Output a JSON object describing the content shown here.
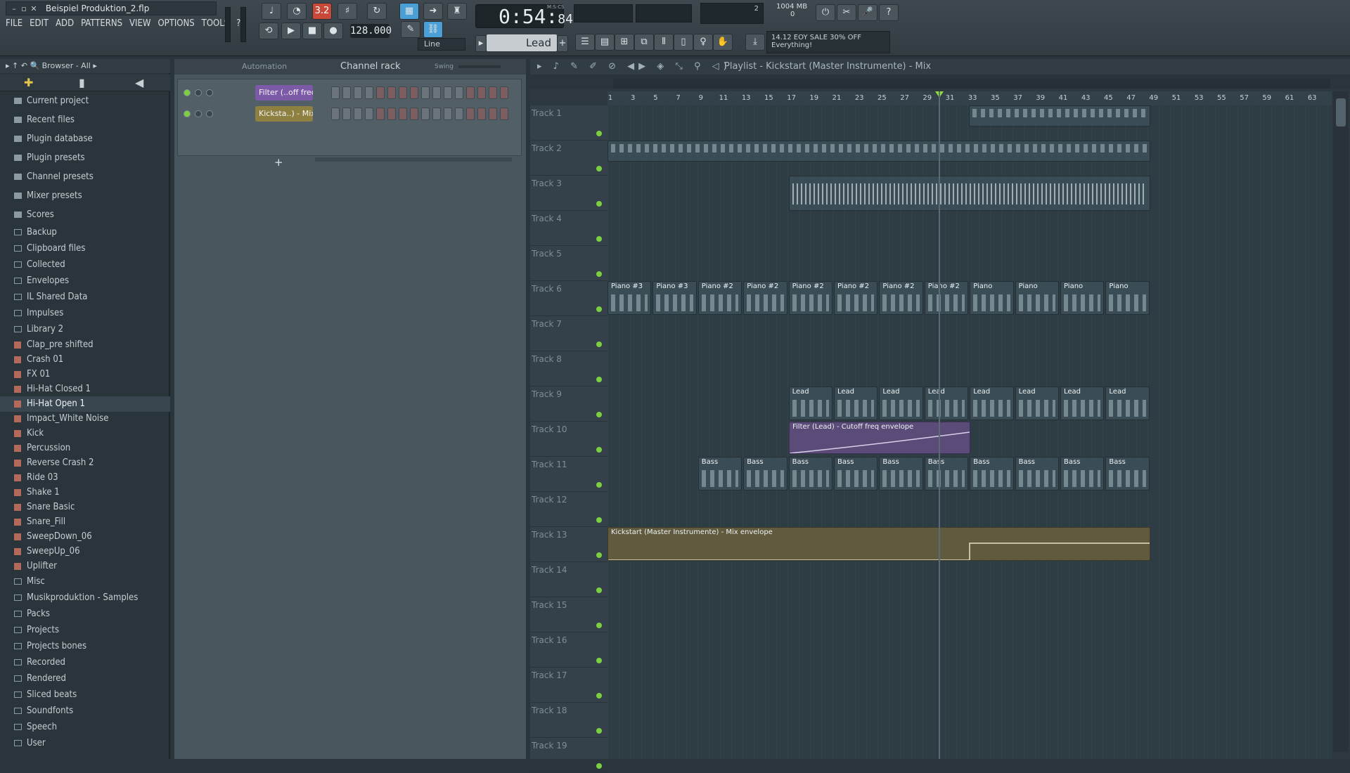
{
  "window": {
    "title": "Beispiel Produktion_2.flp"
  },
  "menu": [
    "FILE",
    "EDIT",
    "ADD",
    "PATTERNS",
    "VIEW",
    "OPTIONS",
    "TOOLS",
    "?"
  ],
  "transport": {
    "song_position": "0:54",
    "song_position_ticks": "84",
    "position_label": "M:S:CS",
    "tempo": "128.000",
    "pattern": "Lead",
    "snap": "Line",
    "counter_top": "2",
    "mem": "1004 MB",
    "counter_bottom": "0"
  },
  "hint": {
    "line1": "14.12  EOY SALE 30% OFF",
    "line2": "Everything!"
  },
  "browser": {
    "title": "Browser - All",
    "items": [
      {
        "label": "Current project",
        "type": "top"
      },
      {
        "label": "Recent files",
        "type": "top"
      },
      {
        "label": "Plugin database",
        "type": "top"
      },
      {
        "label": "Plugin presets",
        "type": "top"
      },
      {
        "label": "Channel presets",
        "type": "top"
      },
      {
        "label": "Mixer presets",
        "type": "top"
      },
      {
        "label": "Scores",
        "type": "top"
      },
      {
        "label": "Backup",
        "type": "folder"
      },
      {
        "label": "Clipboard files",
        "type": "folder"
      },
      {
        "label": "Collected",
        "type": "folder"
      },
      {
        "label": "Envelopes",
        "type": "folder"
      },
      {
        "label": "IL Shared Data",
        "type": "folder"
      },
      {
        "label": "Impulses",
        "type": "folder"
      },
      {
        "label": "Library 2",
        "type": "folder"
      },
      {
        "label": "Clap_pre shifted",
        "type": "file"
      },
      {
        "label": "Crash 01",
        "type": "file"
      },
      {
        "label": "FX 01",
        "type": "file"
      },
      {
        "label": "Hi-Hat Closed 1",
        "type": "file"
      },
      {
        "label": "Hi-Hat Open 1",
        "type": "file"
      },
      {
        "label": "Impact_White Noise",
        "type": "file"
      },
      {
        "label": "Kick",
        "type": "file"
      },
      {
        "label": "Percussion",
        "type": "file"
      },
      {
        "label": "Reverse Crash 2",
        "type": "file"
      },
      {
        "label": "Ride 03",
        "type": "file"
      },
      {
        "label": "Shake 1",
        "type": "file"
      },
      {
        "label": "Snare Basic",
        "type": "file"
      },
      {
        "label": "Snare_Fill",
        "type": "file"
      },
      {
        "label": "SweepDown_06",
        "type": "file"
      },
      {
        "label": "SweepUp_06",
        "type": "file"
      },
      {
        "label": "Uplifter",
        "type": "file"
      },
      {
        "label": "Misc",
        "type": "folder"
      },
      {
        "label": "Musikproduktion - Samples",
        "type": "folder"
      },
      {
        "label": "Packs",
        "type": "folder"
      },
      {
        "label": "Projects",
        "type": "folder"
      },
      {
        "label": "Projects bones",
        "type": "folder"
      },
      {
        "label": "Recorded",
        "type": "folder"
      },
      {
        "label": "Rendered",
        "type": "folder"
      },
      {
        "label": "Sliced beats",
        "type": "folder"
      },
      {
        "label": "Soundfonts",
        "type": "folder"
      },
      {
        "label": "Speech",
        "type": "folder"
      },
      {
        "label": "User",
        "type": "folder"
      }
    ]
  },
  "channel_rack": {
    "title": "Channel rack",
    "filter": "Automation",
    "swing_label": "Swing",
    "channels": [
      {
        "name": "Filter (..off freq",
        "color": "#7d5aa8"
      },
      {
        "name": "Kicksta..) - Mix",
        "color": "#8d8040"
      }
    ]
  },
  "playlist": {
    "title": "Playlist - Kickstart (Master Instrumente) - Mix",
    "ruler": [
      "1",
      "3",
      "5",
      "7",
      "9",
      "11",
      "13",
      "15",
      "17",
      "19",
      "21",
      "23",
      "25",
      "27",
      "29",
      "31",
      "33",
      "35",
      "37",
      "39",
      "41",
      "43",
      "45",
      "47",
      "49",
      "51",
      "53",
      "55",
      "57",
      "59",
      "61",
      "63"
    ],
    "tracks": [
      "Track 1",
      "Track 2",
      "Track 3",
      "Track 4",
      "Track 5",
      "Track 6",
      "Track 7",
      "Track 8",
      "Track 9",
      "Track 10",
      "Track 11",
      "Track 12",
      "Track 13",
      "Track 14",
      "Track 15",
      "Track 16",
      "Track 17",
      "Track 18",
      "Track 19"
    ],
    "clips": [
      {
        "track": 6,
        "label": "Piano #3",
        "bar": 1
      },
      {
        "track": 6,
        "label": "Piano #3",
        "bar": 5
      },
      {
        "track": 6,
        "label": "Piano #2",
        "bar": 9
      },
      {
        "track": 6,
        "label": "Piano #2",
        "bar": 13
      },
      {
        "track": 6,
        "label": "Piano #2",
        "bar": 17
      },
      {
        "track": 6,
        "label": "Piano #2",
        "bar": 21
      },
      {
        "track": 6,
        "label": "Piano #2",
        "bar": 25
      },
      {
        "track": 6,
        "label": "Piano #2",
        "bar": 29
      },
      {
        "track": 6,
        "label": "Piano",
        "bar": 33
      },
      {
        "track": 6,
        "label": "Piano",
        "bar": 37
      },
      {
        "track": 6,
        "label": "Piano",
        "bar": 41
      },
      {
        "track": 6,
        "label": "Piano",
        "bar": 45
      },
      {
        "track": 9,
        "label": "Lead",
        "bar": 17
      },
      {
        "track": 9,
        "label": "Lead",
        "bar": 21
      },
      {
        "track": 9,
        "label": "Lead",
        "bar": 25
      },
      {
        "track": 9,
        "label": "Lead",
        "bar": 29
      },
      {
        "track": 9,
        "label": "Lead",
        "bar": 33
      },
      {
        "track": 9,
        "label": "Lead",
        "bar": 37
      },
      {
        "track": 9,
        "label": "Lead",
        "bar": 41
      },
      {
        "track": 9,
        "label": "Lead",
        "bar": 45
      },
      {
        "track": 11,
        "label": "Bass",
        "bar": 9
      },
      {
        "track": 11,
        "label": "Bass",
        "bar": 13
      },
      {
        "track": 11,
        "label": "Bass",
        "bar": 17
      },
      {
        "track": 11,
        "label": "Bass",
        "bar": 21
      },
      {
        "track": 11,
        "label": "Bass",
        "bar": 25
      },
      {
        "track": 11,
        "label": "Bass",
        "bar": 29
      },
      {
        "track": 11,
        "label": "Bass",
        "bar": 33
      },
      {
        "track": 11,
        "label": "Bass",
        "bar": 37
      },
      {
        "track": 11,
        "label": "Bass",
        "bar": 41
      },
      {
        "track": 11,
        "label": "Bass",
        "bar": 45
      }
    ],
    "env_filter": "Filter (Lead) - Cutoff freq envelope",
    "env_master": "Kickstart (Master Instrumente) - Mix envelope"
  }
}
